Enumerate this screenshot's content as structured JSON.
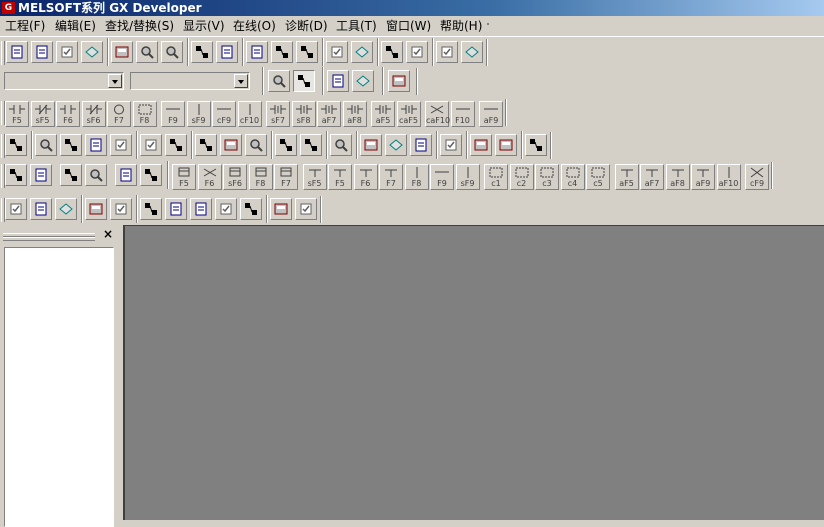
{
  "window": {
    "title": "MELSOFT系列 GX Developer"
  },
  "menu": [
    "工程(F)",
    "编辑(E)",
    "查找/替换(S)",
    "显示(V)",
    "在线(O)",
    "诊断(D)",
    "工具(T)",
    "窗口(W)",
    "帮助(H)"
  ],
  "toolbar1": [
    "new-project-icon",
    "open-project-icon",
    "save-icon",
    "print-icon",
    "cut-icon",
    "copy-icon",
    "paste-icon",
    "undo-icon",
    "redo-icon",
    "find-device-icon",
    "find-instruction-icon",
    "find-step-icon",
    "write-to-plc-icon",
    "transfer-icon",
    "monitor-icon",
    "monitor-stop-icon",
    "device-batch-icon",
    "device-test-icon"
  ],
  "toolbar2": {
    "combo1_value": "",
    "combo2_value": "",
    "buttons": [
      "program-list-icon",
      "project-tree-icon",
      "device-comment-icon",
      "parameter-icon",
      "ladder-view-icon"
    ]
  },
  "fkeys1": [
    {
      "icon": "no-contact-icon",
      "label": "F5"
    },
    {
      "icon": "nc-contact-icon",
      "label": "sF5"
    },
    {
      "icon": "no-contact-parallel-icon",
      "label": "F6"
    },
    {
      "icon": "nc-contact-parallel-icon",
      "label": "sF6"
    },
    {
      "icon": "coil-icon",
      "label": "F7"
    },
    {
      "icon": "application-instruction-icon",
      "label": "F8"
    },
    {
      "icon": "horizontal-line-icon",
      "label": "F9"
    },
    {
      "icon": "vertical-line-icon",
      "label": "sF9"
    },
    {
      "icon": "delete-horizontal-icon",
      "label": "cF9"
    },
    {
      "icon": "delete-vertical-icon",
      "label": "cF10"
    },
    {
      "icon": "rising-pulse-icon",
      "label": "sF7"
    },
    {
      "icon": "falling-pulse-icon",
      "label": "sF8"
    },
    {
      "icon": "rising-pulse-parallel-icon",
      "label": "aF7"
    },
    {
      "icon": "falling-pulse-parallel-icon",
      "label": "aF8"
    },
    {
      "icon": "operation-rising-icon",
      "label": "aF5"
    },
    {
      "icon": "operation-falling-icon",
      "label": "caF5"
    },
    {
      "icon": "invert-icon",
      "label": "caF10"
    },
    {
      "icon": "line-draw-icon",
      "label": "F10"
    },
    {
      "icon": "line-delete-icon",
      "label": "aF9"
    }
  ],
  "toolbar3": [
    "read-mode-icon",
    "write-mode-icon",
    "monitor-mode-icon",
    "monitor-write-icon",
    "instruction-list-icon",
    "ladder-symbol-icon",
    "sfc-icon",
    "sfc-block-icon",
    "step-icon",
    "zoom-icon",
    "comment-edit-icon",
    "statement-edit-icon",
    "note-edit-icon",
    "comment-display-icon",
    "alias-display-icon",
    "macro-icon",
    "entry-monitor-icon",
    "device-register-icon",
    "buffer-memory-icon",
    "display-icon"
  ],
  "fkeys2": [
    {
      "icon": "step-sfc-icon",
      "label": "F5"
    },
    {
      "icon": "block-start-icon",
      "label": "F6"
    },
    {
      "icon": "end-step-icon",
      "label": "sF6"
    },
    {
      "icon": "jump-icon",
      "label": "F8"
    },
    {
      "icon": "transition-icon",
      "label": "F7"
    },
    {
      "icon": "selective-branch-icon",
      "label": "sF5"
    },
    {
      "icon": "parallel-branch-icon",
      "label": "F5"
    },
    {
      "icon": "selective-join-icon",
      "label": "F6"
    },
    {
      "icon": "parallel-join-icon",
      "label": "F7"
    },
    {
      "icon": "vertical-sfc-icon",
      "label": "F8"
    },
    {
      "icon": "branch-line-icon",
      "label": "F9"
    },
    {
      "icon": "vertical-line-sfc-icon",
      "label": "sF9"
    },
    {
      "icon": "comment-box-icon",
      "label": "c1"
    },
    {
      "icon": "sc-box-icon",
      "label": "c2"
    },
    {
      "icon": "se-box-icon",
      "label": "c3"
    },
    {
      "icon": "st-box-icon",
      "label": "c4"
    },
    {
      "icon": "r-box-icon",
      "label": "c5"
    },
    {
      "icon": "selective-branch-2-icon",
      "label": "aF5"
    },
    {
      "icon": "parallel-branch-2-icon",
      "label": "aF7"
    },
    {
      "icon": "selective-join-2-icon",
      "label": "aF8"
    },
    {
      "icon": "parallel-join-2-icon",
      "label": "aF9"
    },
    {
      "icon": "vertical-2-icon",
      "label": "aF10"
    },
    {
      "icon": "delete-sfc-icon",
      "label": "cF9"
    }
  ],
  "toolbar5": [
    "find-device-2-icon",
    "jump-to-icon",
    "find-back-icon",
    "list-icon",
    "program-check-icon",
    "batch-icon",
    "replace-icon",
    "device-usage-icon",
    "reference-icon",
    "cross-reference-icon",
    "sample-icon",
    "hand-icon"
  ],
  "leftpane": {
    "close": "×"
  }
}
